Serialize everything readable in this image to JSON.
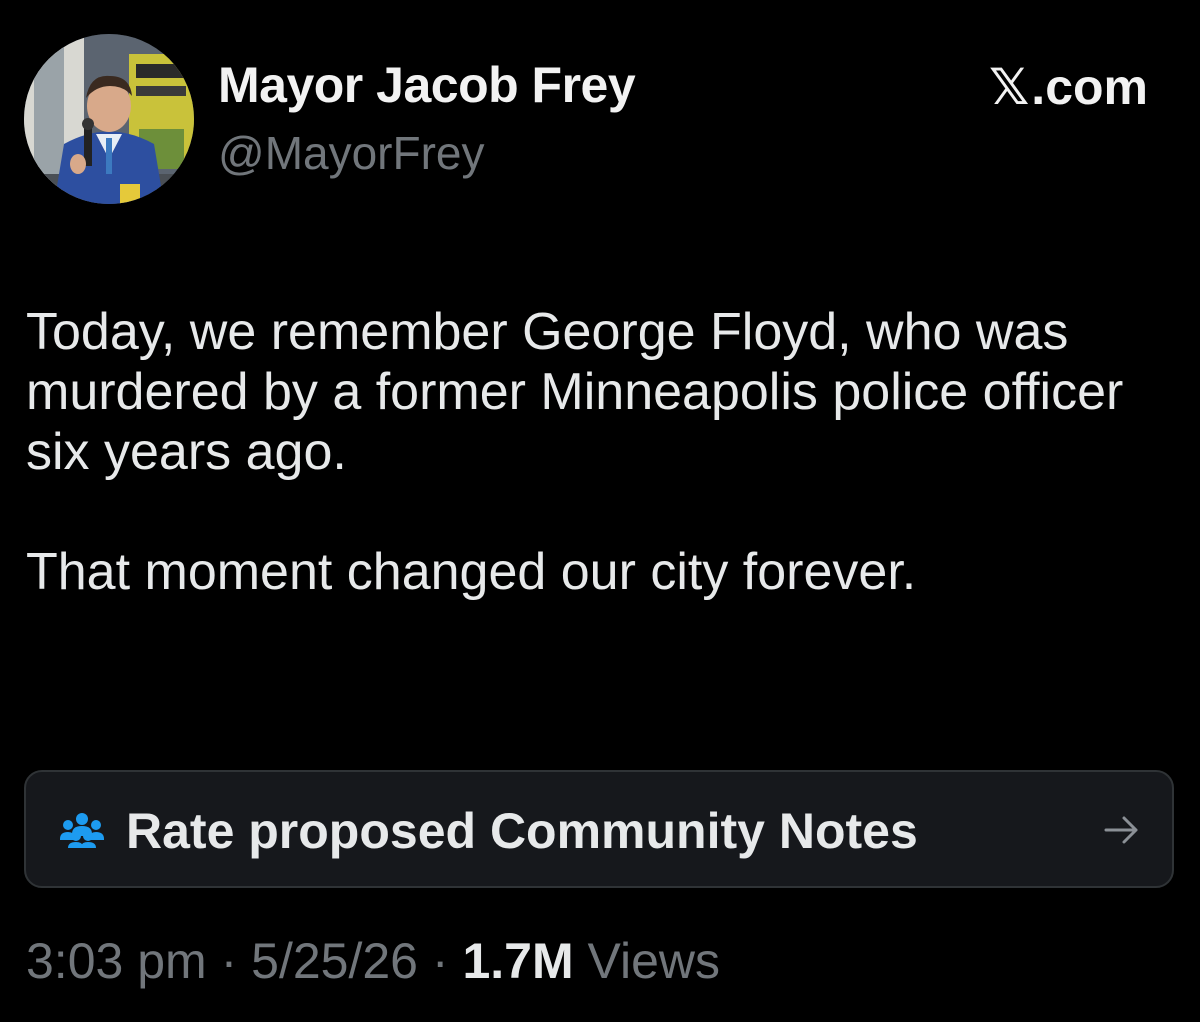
{
  "author": {
    "name": "Mayor Jacob Frey",
    "handle": "@MayorFrey"
  },
  "brand": {
    "glyph": "𝕏",
    "suffix": ".com"
  },
  "tweet": {
    "paragraph1": "Today, we remember George Floyd, who was murdered by a former Minneapolis police officer six years ago.",
    "paragraph2": "That moment changed our city forever."
  },
  "community_notes": {
    "label": "Rate proposed Community Notes",
    "icon": "people-icon",
    "arrow_icon": "arrow-right-icon",
    "icon_color": "#1d9bf0"
  },
  "meta": {
    "time": "3:03 pm",
    "date": "5/25/26",
    "separator": "·",
    "views_count": "1.7M",
    "views_label": "Views"
  },
  "colors": {
    "background": "#000000",
    "text": "#e7e9ea",
    "secondary": "#71767b",
    "card_border": "#2f3336",
    "card_bg": "#16181c"
  }
}
